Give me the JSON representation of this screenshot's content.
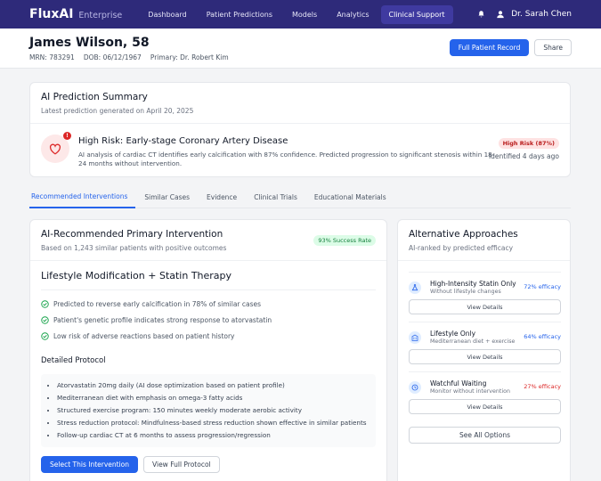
{
  "nav": {
    "brand": "FluxAI",
    "brand_sub": "Enterprise",
    "items": [
      {
        "label": "Dashboard"
      },
      {
        "label": "Patient Predictions"
      },
      {
        "label": "Models"
      },
      {
        "label": "Analytics"
      },
      {
        "label": "Clinical Support"
      }
    ],
    "active_index": 4,
    "user_name": "Dr. Sarah Chen"
  },
  "patient": {
    "name": "James Wilson, 58",
    "mrn": "MRN: 783291",
    "dob": "DOB: 06/12/1967",
    "primary": "Primary: Dr. Robert Kim",
    "full_record_label": "Full Patient Record",
    "share_label": "Share"
  },
  "summary": {
    "title": "AI Prediction Summary",
    "subtitle": "Latest prediction generated on April 20, 2025",
    "risk_title": "High Risk: Early-stage Coronary Artery Disease",
    "risk_desc": "AI analysis of cardiac CT identifies early calcification with 87% confidence. Predicted progression to significant stenosis within 18-24 months without intervention.",
    "risk_badge": "High Risk (87%)",
    "risk_when": "Identified 4 days ago",
    "alert_glyph": "!"
  },
  "tabs": [
    {
      "label": "Recommended Interventions"
    },
    {
      "label": "Similar Cases"
    },
    {
      "label": "Evidence"
    },
    {
      "label": "Clinical Trials"
    },
    {
      "label": "Educational Materials"
    }
  ],
  "primary": {
    "title": "AI-Recommended Primary Intervention",
    "subtitle": "Based on 1,243 similar patients with positive outcomes",
    "success_badge": "93% Success Rate",
    "intervention": "Lifestyle Modification + Statin Therapy",
    "checks": [
      "Predicted to reverse early calcification in 78% of similar cases",
      "Patient's genetic profile indicates strong response to atorvastatin",
      "Low risk of adverse reactions based on patient history"
    ],
    "protocol_title": "Detailed Protocol",
    "protocol": [
      "Atorvastatin 20mg daily (AI dose optimization based on patient profile)",
      "Mediterranean diet with emphasis on omega-3 fatty acids",
      "Structured exercise program: 150 minutes weekly moderate aerobic activity",
      "Stress reduction protocol: Mindfulness-based stress reduction shown effective in similar patients",
      "Follow-up cardiac CT at 6 months to assess progression/regression"
    ],
    "select_label": "Select This Intervention",
    "view_label": "View Full Protocol"
  },
  "alternatives": {
    "title": "Alternative Approaches",
    "subtitle": "AI-ranked by predicted efficacy",
    "items": [
      {
        "name": "High-Intensity Statin Only",
        "sub": "Without lifestyle changes",
        "efficacy": "72% efficacy",
        "details": "View Details"
      },
      {
        "name": "Lifestyle Only",
        "sub": "Mediterranean diet + exercise",
        "efficacy": "64% efficacy",
        "details": "View Details"
      },
      {
        "name": "Watchful Waiting",
        "sub": "Monitor without intervention",
        "efficacy": "27% efficacy",
        "details": "View Details"
      }
    ],
    "see_all": "See All Options"
  },
  "colors": {
    "nav_bg": "#2e2a7a",
    "primary": "#2563eb",
    "risk": "#dc2626",
    "success": "#15803d"
  }
}
